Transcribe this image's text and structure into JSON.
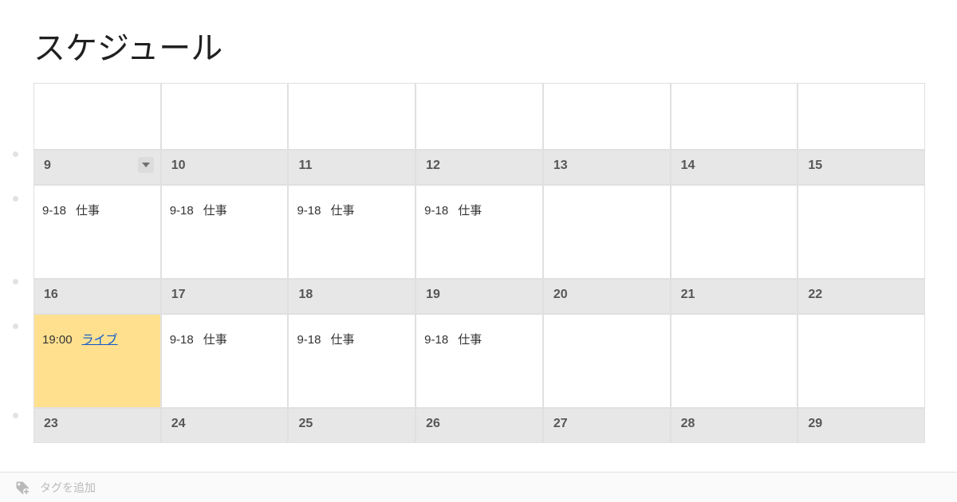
{
  "title": "スケジュール",
  "tagbar": {
    "placeholder": "タグを追加"
  },
  "weeks": [
    {
      "days": [
        "9",
        "10",
        "11",
        "12",
        "13",
        "14",
        "15"
      ],
      "cells": [
        {
          "time": "9-18",
          "label": "仕事"
        },
        {
          "time": "9-18",
          "label": "仕事"
        },
        {
          "time": "9-18",
          "label": "仕事"
        },
        {
          "time": "9-18",
          "label": "仕事"
        },
        {},
        {},
        {}
      ]
    },
    {
      "days": [
        "16",
        "17",
        "18",
        "19",
        "20",
        "21",
        "22"
      ],
      "cells": [
        {
          "time": "19:00",
          "label": "ライブ",
          "link": true,
          "highlight": true
        },
        {
          "time": "9-18",
          "label": "仕事"
        },
        {
          "time": "9-18",
          "label": "仕事"
        },
        {
          "time": "9-18",
          "label": "仕事"
        },
        {},
        {},
        {}
      ]
    },
    {
      "days": [
        "23",
        "24",
        "25",
        "26",
        "27",
        "28",
        "29"
      ],
      "cells": [
        {},
        {},
        {},
        {},
        {},
        {},
        {}
      ]
    }
  ]
}
